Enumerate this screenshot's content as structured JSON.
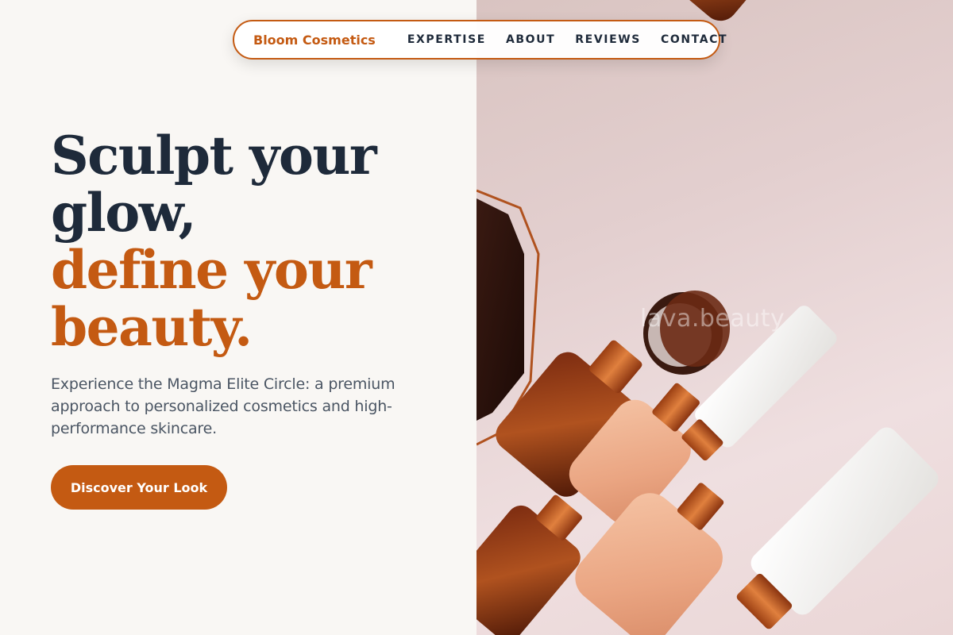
{
  "brand": {
    "name": "Bloom Cosmetics"
  },
  "nav": {
    "links": [
      "EXPERTISE",
      "ABOUT",
      "REVIEWS",
      "CONTACT"
    ]
  },
  "hero": {
    "headline_line1": "Sculpt your",
    "headline_line2": "glow,",
    "headline_line3": "define your",
    "headline_line4": "beauty.",
    "subtext": "Experience the Magma Elite Circle: a premium approach to personalized cosmetics and high-performance skincare.",
    "cta_label": "Discover Your Look"
  },
  "image": {
    "watermark": "lava.beauty"
  },
  "colors": {
    "accent": "#c45a12",
    "dark_text": "#1e2a3a",
    "body_text": "#4a5563",
    "left_background": "#f9f7f4",
    "photo_background": "#e6d3d3"
  }
}
